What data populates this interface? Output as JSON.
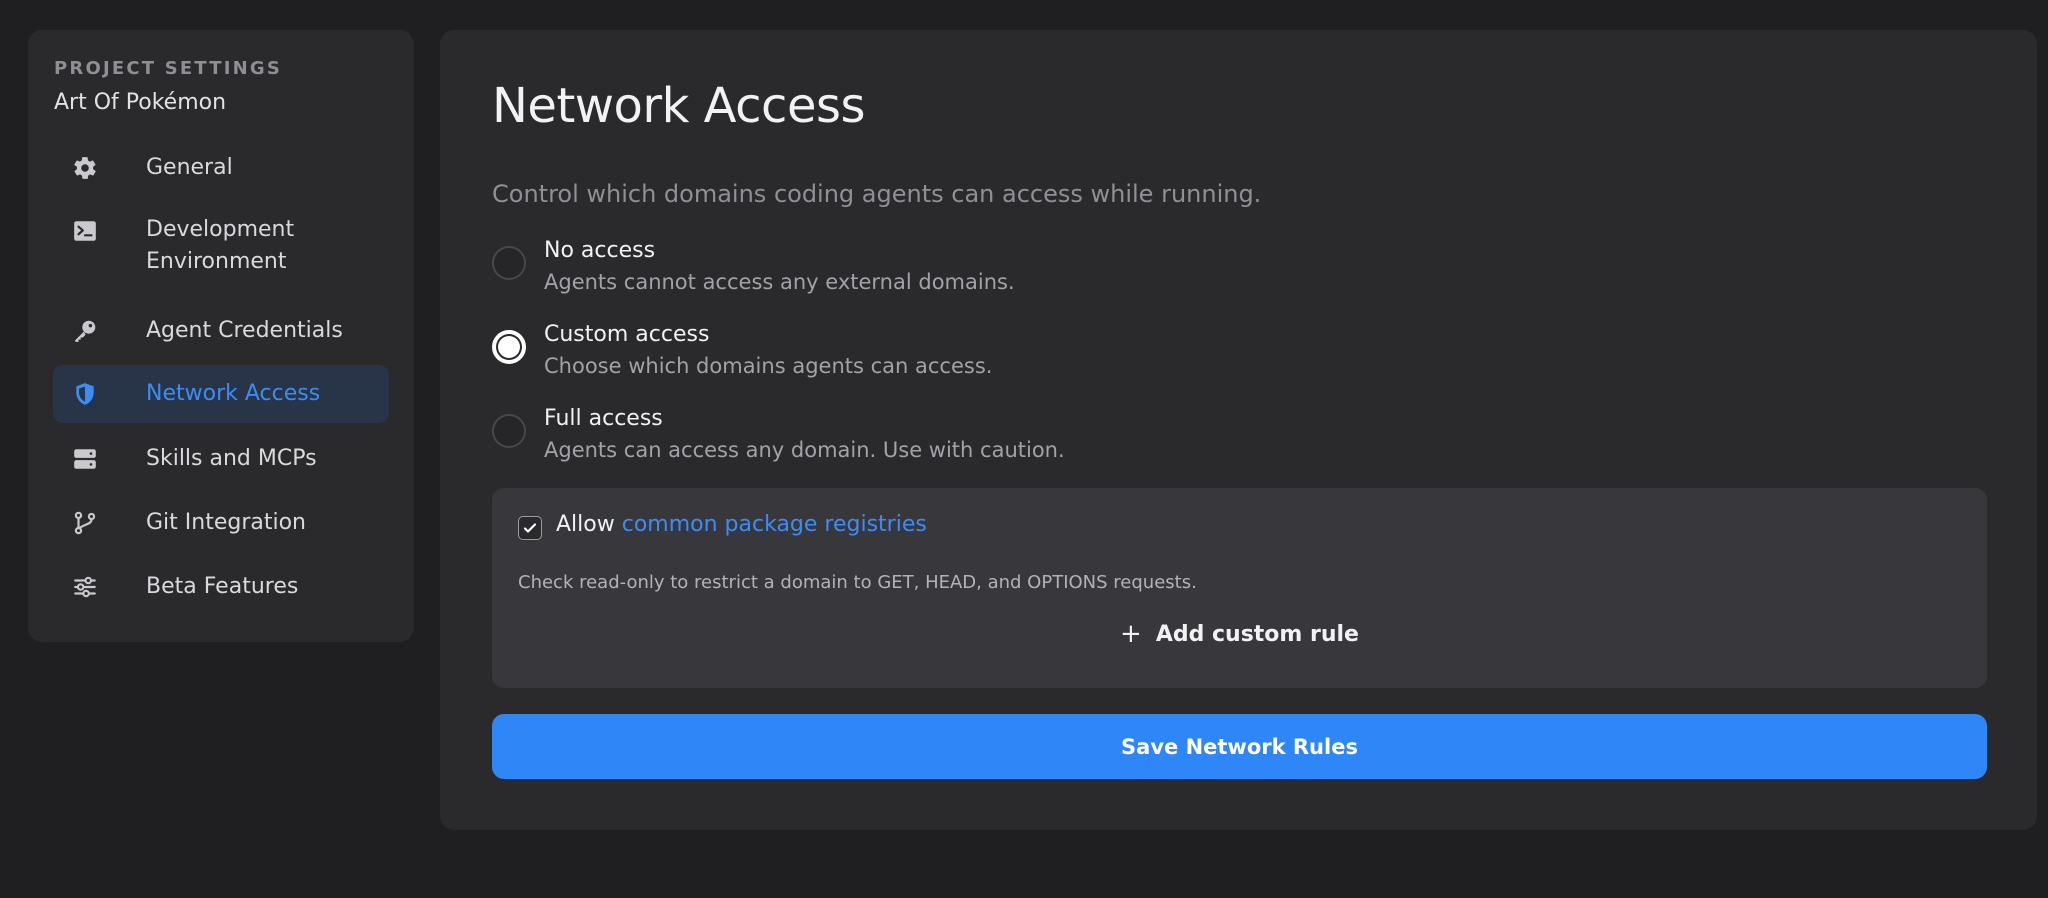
{
  "sidebar": {
    "section_label": "PROJECT SETTINGS",
    "project_name": "Art Of Pokémon",
    "items": [
      {
        "label": "General",
        "icon": "gear-icon"
      },
      {
        "label": "Development Environment",
        "icon": "terminal-icon"
      },
      {
        "label": "Agent Credentials",
        "icon": "key-icon"
      },
      {
        "label": "Network Access",
        "icon": "shield-icon",
        "active": true
      },
      {
        "label": "Skills and MCPs",
        "icon": "server-icon"
      },
      {
        "label": "Git Integration",
        "icon": "git-branch-icon"
      },
      {
        "label": "Beta Features",
        "icon": "sliders-icon"
      }
    ]
  },
  "main": {
    "title": "Network Access",
    "subtitle": "Control which domains coding agents can access while running.",
    "options": [
      {
        "title": "No access",
        "description": "Agents cannot access any external domains.",
        "selected": false
      },
      {
        "title": "Custom access",
        "description": "Choose which domains agents can access.",
        "selected": true
      },
      {
        "title": "Full access",
        "description": "Agents can access any domain. Use with caution.",
        "selected": false
      }
    ],
    "rules": {
      "allow_prefix": "Allow",
      "allow_link": "common package registries",
      "allow_checked": true,
      "hint": "Check read-only to restrict a domain to GET, HEAD, and OPTIONS requests.",
      "add_rule_label": "Add custom rule"
    },
    "save_label": "Save Network Rules"
  },
  "colors": {
    "accent": "#2f86f6",
    "active_nav_bg": "#283548",
    "panel_bg": "#2a2a2d",
    "page_bg": "#1f1f21"
  }
}
